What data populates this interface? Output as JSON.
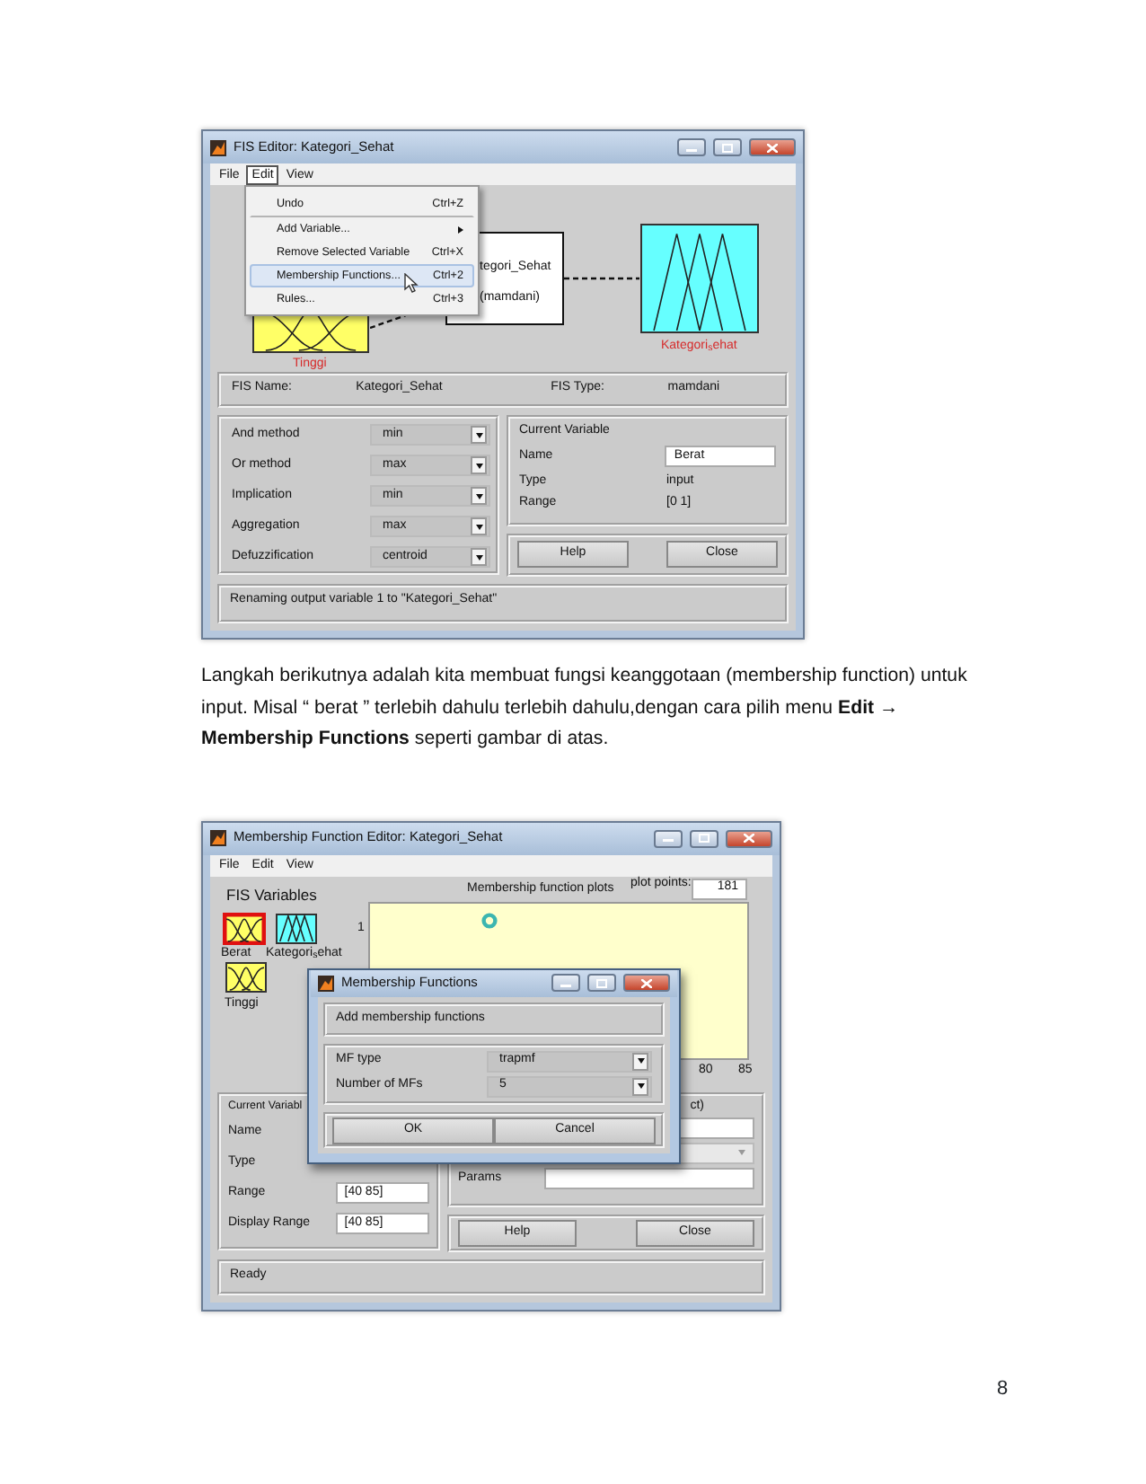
{
  "fis_editor": {
    "title": "FIS Editor: Kategori_Sehat",
    "menu": [
      {
        "label": "File",
        "selected": false
      },
      {
        "label": "Edit",
        "selected": true
      },
      {
        "label": "View",
        "selected": false
      }
    ],
    "edit_menu": [
      {
        "label": "Undo",
        "shortcut": "Ctrl+Z",
        "submenu": false,
        "highlighted": false,
        "separator_after": true
      },
      {
        "label": "Add Variable...",
        "submenu": true,
        "highlighted": false,
        "separator_after": false
      },
      {
        "label": "Remove Selected Variable",
        "shortcut": "Ctrl+X",
        "submenu": false,
        "highlighted": false,
        "separator_after": false
      },
      {
        "label": "Membership Functions...",
        "shortcut": "Ctrl+2",
        "submenu": false,
        "highlighted": true,
        "separator_after": false
      },
      {
        "label": "Rules...",
        "shortcut": "Ctrl+3",
        "submenu": false,
        "highlighted": false,
        "separator_after": false
      }
    ],
    "diagram": {
      "input": "Tinggi",
      "system_lines": [
        "tegori_Sehat",
        "(mamdani)"
      ],
      "output": "Kategori$_{s}$ehat"
    },
    "fis_name": {
      "label": "FIS Name:",
      "value": "Kategori_Sehat"
    },
    "fis_type": {
      "label": "FIS Type:",
      "value": "mamdani"
    },
    "methods": [
      {
        "label": "And method",
        "value": "min"
      },
      {
        "label": "Or method",
        "value": "max"
      },
      {
        "label": "Implication",
        "value": "min"
      },
      {
        "label": "Aggregation",
        "value": "max"
      },
      {
        "label": "Defuzzification",
        "value": "centroid"
      }
    ],
    "current_variable": {
      "title": "Current Variable",
      "fields": [
        {
          "label": "Name",
          "value": "Berat",
          "kind": "input"
        },
        {
          "label": "Type",
          "value": "input",
          "kind": "text"
        },
        {
          "label": "Range",
          "value": "[0 1]",
          "kind": "text"
        }
      ]
    },
    "buttons": [
      "Help",
      "Close"
    ],
    "status": "Renaming output variable 1 to \"Kategori_Sehat\""
  },
  "paragraph": "Langkah berikutnya adalah kita membuat fungsi keanggotaan (membership function) untuk input. Misal “ berat ” terlebih dahulu terlebih dahulu,dengan cara pilih menu **Edit → Membership Functions** seperti gambar di atas.",
  "mf_editor": {
    "title": "Membership Function Editor: Kategori_Sehat",
    "menu": [
      {
        "label": "File",
        "selected": false
      },
      {
        "label": "Edit",
        "selected": false
      },
      {
        "label": "View",
        "selected": false
      }
    ],
    "variables_title": "FIS Variables",
    "variables": [
      {
        "label": "Berat",
        "kind": "input",
        "selected": true
      },
      {
        "label": "Kategori$_{s}$ehat",
        "kind": "output",
        "selected": false
      },
      {
        "label": "Tinggi",
        "kind": "input",
        "selected": false
      }
    ],
    "plot": {
      "title": "Membership function plots",
      "points_label": "plot points:",
      "points_value": "181",
      "y_tick": "1",
      "x_ticks": [
        "80",
        "85"
      ]
    },
    "current_variable": {
      "title": "Current Variabl",
      "fields": [
        {
          "label": "Name",
          "kind": "hidden"
        },
        {
          "label": "Type",
          "kind": "hidden"
        },
        {
          "label": "Range",
          "value": "[40 85]",
          "kind": "input"
        },
        {
          "label": "Display Range",
          "value": "[40 85]",
          "kind": "input"
        }
      ]
    },
    "mf_panel": {
      "fragment": "ct)",
      "params_label": "Params"
    },
    "buttons": [
      "Help",
      "Close"
    ],
    "status": "Ready",
    "dialog": {
      "title": "Membership Functions",
      "heading": "Add membership functions",
      "fields": [
        {
          "label": "MF type",
          "value": "trapmf"
        },
        {
          "label": "Number of MFs",
          "value": "5"
        }
      ],
      "buttons": [
        "OK",
        "Cancel"
      ]
    }
  },
  "page_number": "8"
}
